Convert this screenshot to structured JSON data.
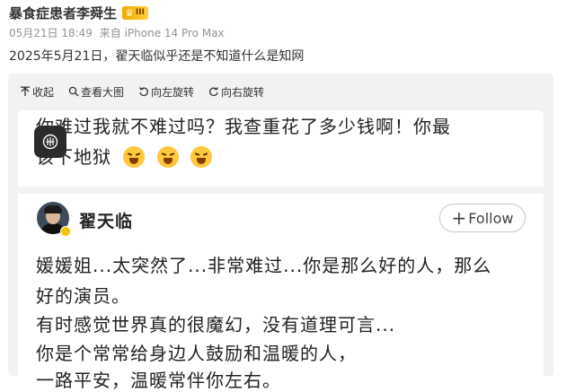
{
  "post": {
    "author": "暴食症患者李舜生",
    "badge_text": "III",
    "date": "05月21日 18:49",
    "source": "来自 iPhone 14 Pro Max",
    "text": "2025年5月21日，翟天临似乎还是不知道什么是知网"
  },
  "toolbar": {
    "collapse": "收起",
    "view_large": "查看大图",
    "rotate_left": "向左旋转",
    "rotate_right": "向右旋转"
  },
  "image": {
    "top_line1": "你难过我就不难过吗？我查重花了多少钱啊！你最",
    "top_line2": "该下地狱",
    "user_name": "翟天临",
    "follow_label": "Follow",
    "lines": [
      "媛媛姐...太突然了...非常难过...你是那么好的人，那么",
      "好的演员。",
      "有时感觉世界真的很魔幻，没有道理可言...",
      "你是个常常给身边人鼓励和温暖的人，",
      "一路平安，温暖常伴你左右。"
    ]
  },
  "icons": {
    "crown": "crown-icon",
    "collapse": "collapse-arrow-icon",
    "zoom": "magnifier-icon",
    "rotate_left": "rotate-left-icon",
    "rotate_right": "rotate-right-icon",
    "float": "floating-app-icon",
    "emoji": "angry-face-emoji",
    "verified": "verified-badge-icon"
  },
  "colors": {
    "badge": "#f2a900",
    "panel": "#f2f2f2",
    "text": "#333333"
  }
}
